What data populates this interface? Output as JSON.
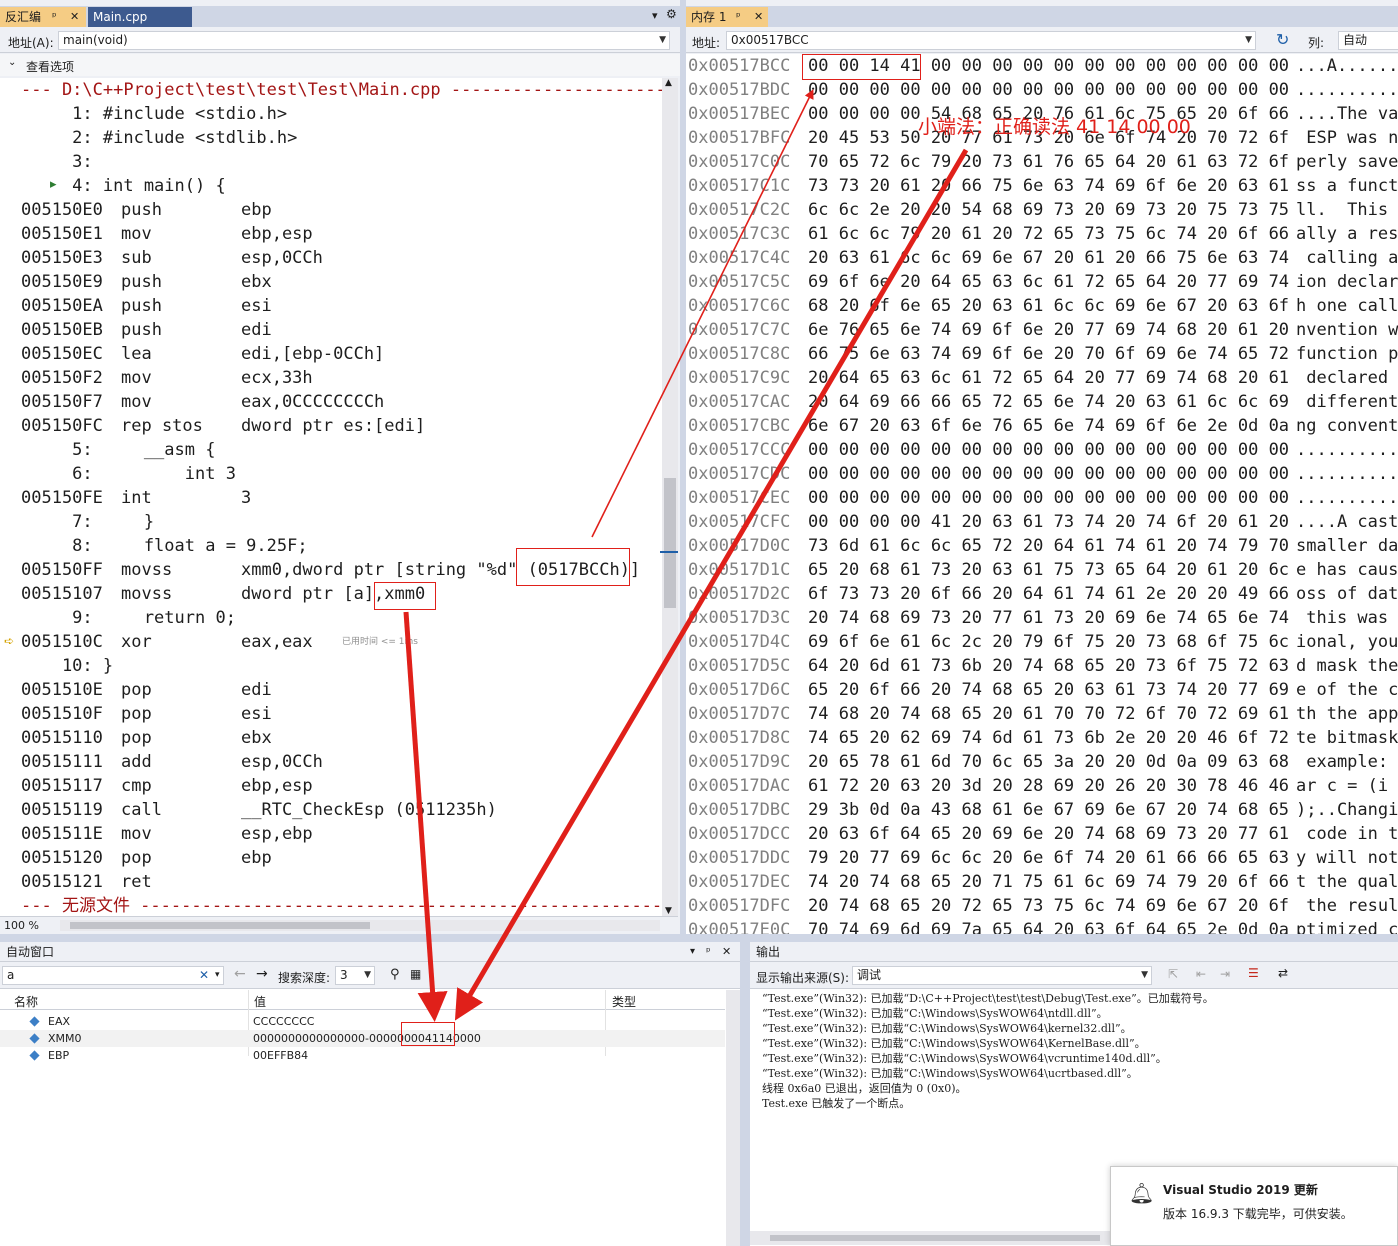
{
  "disasm_tabs": {
    "active": "反汇编",
    "pin": "ᵖ",
    "close": "✕",
    "file_tab": "Main.cpp",
    "menu": "▾",
    "gear": "⚙"
  },
  "disasm_address": {
    "label": "地址(A):",
    "value": "main(void)"
  },
  "disasm_options": "查看选项",
  "disasm_lines": [
    {
      "kind": "sep",
      "text": "--- D:\\C++Project\\test\\test\\Test\\Main.cpp -------------------------------"
    },
    {
      "kind": "src",
      "text": "     1: #include <stdio.h>"
    },
    {
      "kind": "src",
      "text": "     2: #include <stdlib.h>"
    },
    {
      "kind": "src",
      "text": "     3: "
    },
    {
      "kind": "src",
      "text": "     4: int main() {"
    },
    {
      "kind": "asm",
      "addr": "005150E0",
      "mn": "push",
      "op": "ebp"
    },
    {
      "kind": "asm",
      "addr": "005150E1",
      "mn": "mov",
      "op": "ebp,esp"
    },
    {
      "kind": "asm",
      "addr": "005150E3",
      "mn": "sub",
      "op": "esp,0CCh"
    },
    {
      "kind": "asm",
      "addr": "005150E9",
      "mn": "push",
      "op": "ebx"
    },
    {
      "kind": "asm",
      "addr": "005150EA",
      "mn": "push",
      "op": "esi"
    },
    {
      "kind": "asm",
      "addr": "005150EB",
      "mn": "push",
      "op": "edi"
    },
    {
      "kind": "asm",
      "addr": "005150EC",
      "mn": "lea",
      "op": "edi,[ebp-0CCh]"
    },
    {
      "kind": "asm",
      "addr": "005150F2",
      "mn": "mov",
      "op": "ecx,33h"
    },
    {
      "kind": "asm",
      "addr": "005150F7",
      "mn": "mov",
      "op": "eax,0CCCCCCCCh"
    },
    {
      "kind": "asm",
      "addr": "005150FC",
      "mn": "rep stos",
      "op": "dword ptr es:[edi]"
    },
    {
      "kind": "src",
      "text": "     5:     __asm {"
    },
    {
      "kind": "src",
      "text": "     6:         int 3"
    },
    {
      "kind": "asm",
      "addr": "005150FE",
      "mn": "int",
      "op": "3"
    },
    {
      "kind": "src",
      "text": "     7:     }"
    },
    {
      "kind": "src",
      "text": "     8:     float a = 9.25F;"
    },
    {
      "kind": "asm",
      "addr": "005150FF",
      "mn": "movss",
      "op": "xmm0,dword ptr [string \"%d\" (0517BCCh)]"
    },
    {
      "kind": "asm",
      "addr": "00515107",
      "mn": "movss",
      "op": "dword ptr [a],xmm0"
    },
    {
      "kind": "src",
      "text": "     9:     return 0;"
    },
    {
      "kind": "asm",
      "addr": "0051510C",
      "mn": "xor",
      "op": "eax,eax",
      "note": "已用时间 <= 1ms"
    },
    {
      "kind": "src",
      "text": "    10: }"
    },
    {
      "kind": "asm",
      "addr": "0051510E",
      "mn": "pop",
      "op": "edi"
    },
    {
      "kind": "asm",
      "addr": "0051510F",
      "mn": "pop",
      "op": "esi"
    },
    {
      "kind": "asm",
      "addr": "00515110",
      "mn": "pop",
      "op": "ebx"
    },
    {
      "kind": "asm",
      "addr": "00515111",
      "mn": "add",
      "op": "esp,0CCh"
    },
    {
      "kind": "asm",
      "addr": "00515117",
      "mn": "cmp",
      "op": "ebp,esp"
    },
    {
      "kind": "asm",
      "addr": "00515119",
      "mn": "call",
      "op": "__RTC_CheckEsp (0511235h)"
    },
    {
      "kind": "asm",
      "addr": "0051511E",
      "mn": "mov",
      "op": "esp,ebp"
    },
    {
      "kind": "asm",
      "addr": "00515120",
      "mn": "pop",
      "op": "ebp"
    },
    {
      "kind": "asm",
      "addr": "00515121",
      "mn": "ret",
      "op": ""
    },
    {
      "kind": "sep",
      "text": "--- 无源文件 -----------------------------------------------------------"
    }
  ],
  "disasm_zoom": "100 %",
  "memory_tab": {
    "label": "内存 1",
    "pin": "ᵖ",
    "close": "✕"
  },
  "memory_address": {
    "label": "地址:",
    "value": "0x00517BCC",
    "col_label": "列:",
    "col_value": "自动"
  },
  "memory_rows": [
    {
      "addr": "0x00517BCC",
      "bytes": "00 00 14 41 00 00 00 00 00 00 00 00 00 00 00 00",
      "ascii": "...A........"
    },
    {
      "addr": "0x00517BDC",
      "bytes": "00 00 00 00 00 00 00 00 00 00 00 00 00 00 00 00",
      "ascii": "............"
    },
    {
      "addr": "0x00517BEC",
      "bytes": "00 00 00 00 54 68 65 20 76 61 6c 75 65 20 6f 66",
      "ascii": "....The va"
    },
    {
      "addr": "0x00517BFC",
      "bytes": "20 45 53 50 20 77 61 73 20 6e 6f 74 20 70 72 6f",
      "ascii": " ESP was n"
    },
    {
      "addr": "0x00517C0C",
      "bytes": "70 65 72 6c 79 20 73 61 76 65 64 20 61 63 72 6f",
      "ascii": "perly save"
    },
    {
      "addr": "0x00517C1C",
      "bytes": "73 73 20 61 20 66 75 6e 63 74 69 6f 6e 20 63 61",
      "ascii": "ss a funct"
    },
    {
      "addr": "0x00517C2C",
      "bytes": "6c 6c 2e 20 20 54 68 69 73 20 69 73 20 75 73 75",
      "ascii": "ll.  This "
    },
    {
      "addr": "0x00517C3C",
      "bytes": "61 6c 6c 79 20 61 20 72 65 73 75 6c 74 20 6f 66",
      "ascii": "ally a res"
    },
    {
      "addr": "0x00517C4C",
      "bytes": "20 63 61 6c 6c 69 6e 67 20 61 20 66 75 6e 63 74",
      "ascii": " calling a"
    },
    {
      "addr": "0x00517C5C",
      "bytes": "69 6f 6e 20 64 65 63 6c 61 72 65 64 20 77 69 74",
      "ascii": "ion declar"
    },
    {
      "addr": "0x00517C6C",
      "bytes": "68 20 6f 6e 65 20 63 61 6c 6c 69 6e 67 20 63 6f",
      "ascii": "h one call"
    },
    {
      "addr": "0x00517C7C",
      "bytes": "6e 76 65 6e 74 69 6f 6e 20 77 69 74 68 20 61 20",
      "ascii": "nvention w"
    },
    {
      "addr": "0x00517C8C",
      "bytes": "66 75 6e 63 74 69 6f 6e 20 70 6f 69 6e 74 65 72",
      "ascii": "function p"
    },
    {
      "addr": "0x00517C9C",
      "bytes": "20 64 65 63 6c 61 72 65 64 20 77 69 74 68 20 61",
      "ascii": " declared "
    },
    {
      "addr": "0x00517CAC",
      "bytes": "20 64 69 66 66 65 72 65 6e 74 20 63 61 6c 6c 69",
      "ascii": " different"
    },
    {
      "addr": "0x00517CBC",
      "bytes": "6e 67 20 63 6f 6e 76 65 6e 74 69 6f 6e 2e 0d 0a",
      "ascii": "ng convent"
    },
    {
      "addr": "0x00517CCC",
      "bytes": "00 00 00 00 00 00 00 00 00 00 00 00 00 00 00 00",
      "ascii": "..........."
    },
    {
      "addr": "0x00517CDC",
      "bytes": "00 00 00 00 00 00 00 00 00 00 00 00 00 00 00 00",
      "ascii": "..........."
    },
    {
      "addr": "0x00517CEC",
      "bytes": "00 00 00 00 00 00 00 00 00 00 00 00 00 00 00 00",
      "ascii": "..........."
    },
    {
      "addr": "0x00517CFC",
      "bytes": "00 00 00 00 41 20 63 61 73 74 20 74 6f 20 61 20",
      "ascii": "....A cast"
    },
    {
      "addr": "0x00517D0C",
      "bytes": "73 6d 61 6c 6c 65 72 20 64 61 74 61 20 74 79 70",
      "ascii": "smaller da"
    },
    {
      "addr": "0x00517D1C",
      "bytes": "65 20 68 61 73 20 63 61 75 73 65 64 20 61 20 6c",
      "ascii": "e has caus"
    },
    {
      "addr": "0x00517D2C",
      "bytes": "6f 73 73 20 6f 66 20 64 61 74 61 2e 20 20 49 66",
      "ascii": "oss of dat"
    },
    {
      "addr": "0x00517D3C",
      "bytes": "20 74 68 69 73 20 77 61 73 20 69 6e 74 65 6e 74",
      "ascii": " this was "
    },
    {
      "addr": "0x00517D4C",
      "bytes": "69 6f 6e 61 6c 2c 20 79 6f 75 20 73 68 6f 75 6c",
      "ascii": "ional, you"
    },
    {
      "addr": "0x00517D5C",
      "bytes": "64 20 6d 61 73 6b 20 74 68 65 20 73 6f 75 72 63",
      "ascii": "d mask the"
    },
    {
      "addr": "0x00517D6C",
      "bytes": "65 20 6f 66 20 74 68 65 20 63 61 73 74 20 77 69",
      "ascii": "e of the c"
    },
    {
      "addr": "0x00517D7C",
      "bytes": "74 68 20 74 68 65 20 61 70 70 72 6f 70 72 69 61",
      "ascii": "th the app"
    },
    {
      "addr": "0x00517D8C",
      "bytes": "74 65 20 62 69 74 6d 61 73 6b 2e 20 20 46 6f 72",
      "ascii": "te bitmask"
    },
    {
      "addr": "0x00517D9C",
      "bytes": "20 65 78 61 6d 70 6c 65 3a 20 20 0d 0a 09 63 68",
      "ascii": " example: "
    },
    {
      "addr": "0x00517DAC",
      "bytes": "61 72 20 63 20 3d 20 28 69 20 26 20 30 78 46 46",
      "ascii": "ar c = (i "
    },
    {
      "addr": "0x00517DBC",
      "bytes": "29 3b 0d 0a 43 68 61 6e 67 69 6e 67 20 74 68 65",
      "ascii": ");..Changi"
    },
    {
      "addr": "0x00517DCC",
      "bytes": "20 63 6f 64 65 20 69 6e 20 74 68 69 73 20 77 61",
      "ascii": " code in t"
    },
    {
      "addr": "0x00517DDC",
      "bytes": "79 20 77 69 6c 6c 20 6e 6f 74 20 61 66 66 65 63",
      "ascii": "y will not"
    },
    {
      "addr": "0x00517DEC",
      "bytes": "74 20 74 68 65 20 71 75 61 6c 69 74 79 20 6f 66",
      "ascii": "t the qual"
    },
    {
      "addr": "0x00517DFC",
      "bytes": "20 74 68 65 20 72 65 73 75 6c 74 69 6e 67 20 6f",
      "ascii": " the resul"
    },
    {
      "addr": "0x00517E0C",
      "bytes": "70 74 69 6d 69 7a 65 64 20 63 6f 64 65 2e 0d 0a",
      "ascii": "ptimized c"
    }
  ],
  "annotation_text": "小端法：正确读法 41 14 00 00",
  "autos": {
    "title": "自动窗口",
    "search_value": "a",
    "depth_label": "搜索深度:",
    "depth_value": "3",
    "columns": [
      "名称",
      "值",
      "类型"
    ],
    "rows": [
      {
        "name": "EAX",
        "value": "CCCCCCCC",
        "type": ""
      },
      {
        "name": "XMM0",
        "value": "0000000000000000-0000000041140000",
        "type": ""
      },
      {
        "name": "EBP",
        "value": "00EFFB84",
        "type": ""
      }
    ]
  },
  "output": {
    "title": "输出",
    "source_label": "显示输出来源(S):",
    "source_value": "调试",
    "lines": [
      "“Test.exe”(Win32): 已加载“D:\\C++Project\\test\\test\\Debug\\Test.exe”。已加载符号。",
      "“Test.exe”(Win32): 已加载“C:\\Windows\\SysWOW64\\ntdll.dll”。",
      "“Test.exe”(Win32): 已加载“C:\\Windows\\SysWOW64\\kernel32.dll”。",
      "“Test.exe”(Win32): 已加载“C:\\Windows\\SysWOW64\\KernelBase.dll”。",
      "“Test.exe”(Win32): 已加载“C:\\Windows\\SysWOW64\\vcruntime140d.dll”。",
      "“Test.exe”(Win32): 已加载“C:\\Windows\\SysWOW64\\ucrtbased.dll”。",
      "线程 0x6a0 已退出，返回值为 0 (0x0)。",
      "Test.exe 已触发了一个断点。"
    ]
  },
  "toast": {
    "title": "Visual Studio 2019 更新",
    "message": "版本 16.9.3 下载完毕，可供安装。"
  },
  "colors": {
    "accent_tab": "#f5cc84",
    "annotation": "#e0201a",
    "address_gray": "#808080"
  }
}
